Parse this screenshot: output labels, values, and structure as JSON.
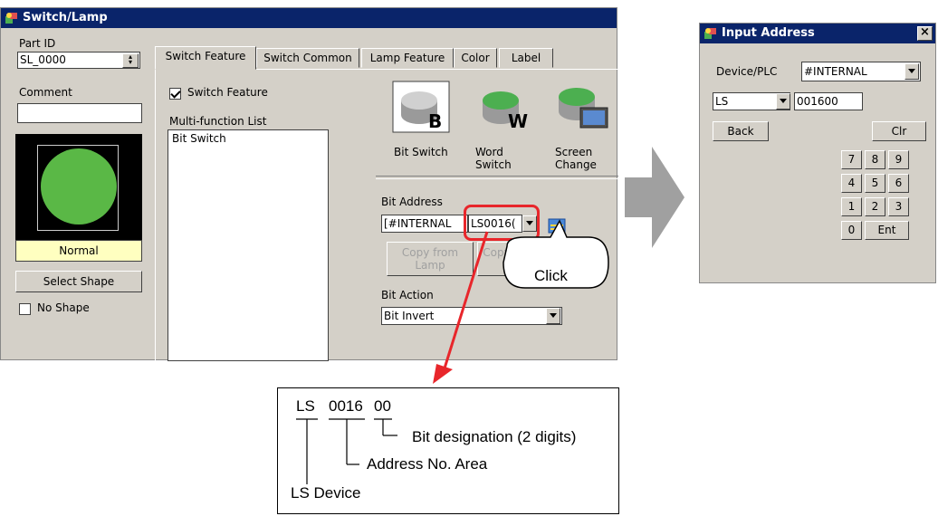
{
  "switch_window": {
    "title": "Switch/Lamp",
    "part_id_label": "Part ID",
    "part_id_value": "SL_0000",
    "comment_label": "Comment",
    "comment_value": "",
    "preview_state": "Normal",
    "select_shape_button": "Select Shape",
    "no_shape_label": "No Shape",
    "tabs": [
      {
        "label": "Switch Feature"
      },
      {
        "label": "Switch Common"
      },
      {
        "label": "Lamp Feature"
      },
      {
        "label": "Color"
      },
      {
        "label": "Label"
      }
    ],
    "switch_feature_label": "Switch Feature",
    "multi_function_label": "Multi-function List",
    "multi_function_items": [
      "Bit Switch"
    ],
    "feature_buttons": [
      {
        "label": "Bit Switch",
        "icon": "bit-switch-icon"
      },
      {
        "label": "Word Switch",
        "icon": "word-switch-icon"
      },
      {
        "label": "Screen Change",
        "icon": "screen-change-icon"
      }
    ],
    "bit_address_label": "Bit Address",
    "bit_address_device": "[#INTERNAL",
    "bit_address_value": "LS0016(",
    "copy_from_lamp": "Copy from Lamp",
    "copy_to_lamp": "Copy to Lamp",
    "click_callout": "Click",
    "bit_action_label": "Bit Action",
    "bit_action_value": "Bit Invert"
  },
  "input_window": {
    "title": "Input Address",
    "device_plc_label": "Device/PLC",
    "device_plc_value": "#INTERNAL",
    "device_type": "LS",
    "address_value": "001600",
    "back_button": "Back",
    "clr_button": "Clr",
    "keys": [
      "7",
      "8",
      "9",
      "4",
      "5",
      "6",
      "1",
      "2",
      "3",
      "0"
    ],
    "ent_button": "Ent"
  },
  "explanation": {
    "device": "LS",
    "address": "0016",
    "bit": "00",
    "bit_desc": "Bit designation (2 digits)",
    "address_desc": "Address No. Area",
    "device_desc": "LS Device"
  },
  "colors": {
    "title_bar": "#0a246a",
    "lamp_green": "#5ab846",
    "state_bg": "#ffffc0",
    "highlight_red": "#e8262b",
    "arrow_gray": "#a0a0a0"
  }
}
